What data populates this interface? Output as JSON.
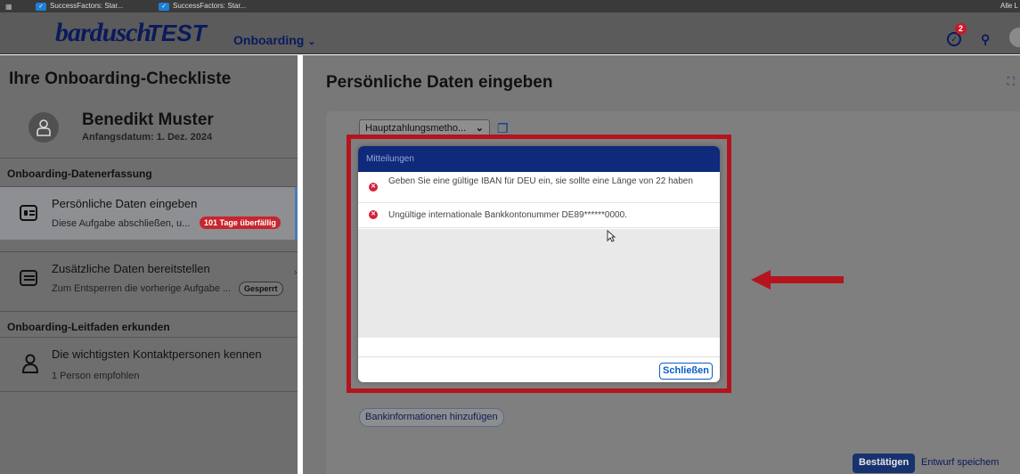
{
  "browser": {
    "tabs": [
      "SuccessFactors: Star...",
      "SuccessFactors: Star..."
    ],
    "right_label": "Alle L"
  },
  "header": {
    "logo": "bardusch",
    "env": "TEST",
    "nav_menu": "Onboarding",
    "notification_count": "2"
  },
  "sidebar": {
    "title": "Ihre Onboarding-Checkliste",
    "profile": {
      "name": "Benedikt Muster",
      "start_date": "Anfangsdatum: 1. Dez. 2024"
    },
    "sections": [
      {
        "heading": "Onboarding-Datenerfassung",
        "tasks": [
          {
            "title": "Persönliche Daten eingeben",
            "subtitle": "Diese Aufgabe abschließen, u...",
            "tag": "101 Tage überfällig"
          },
          {
            "title": "Zusätzliche Daten bereitstellen",
            "subtitle": "Zum Entsperren die vorherige Aufgabe ...",
            "tag": "Gesperrt"
          }
        ]
      },
      {
        "heading": "Onboarding-Leitfaden erkunden",
        "tasks": [
          {
            "title": "Die wichtigsten Kontaktpersonen kennen",
            "subtitle": "1 Person empfohlen"
          }
        ]
      }
    ]
  },
  "main": {
    "title": "Persönliche Daten eingeben",
    "select_value": "Hauptzahlungsmetho...",
    "add_bank_button": "Bankinformationen hinzufügen",
    "confirm_button": "Bestätigen",
    "draft_button": "Entwurf speichem"
  },
  "dialog": {
    "title": "Mitteilungen",
    "messages": [
      "Geben Sie eine gültige IBAN für DEU ein, sie sollte eine Länge von 22 haben",
      "Ungültige internationale Bankkontonummer DE89******0000."
    ],
    "close_button": "Schließen"
  },
  "colors": {
    "highlight": "#b4141e",
    "dialog_header": "#0f2a7a",
    "error": "#d6203a",
    "overdue_tag": "#c8252d"
  }
}
